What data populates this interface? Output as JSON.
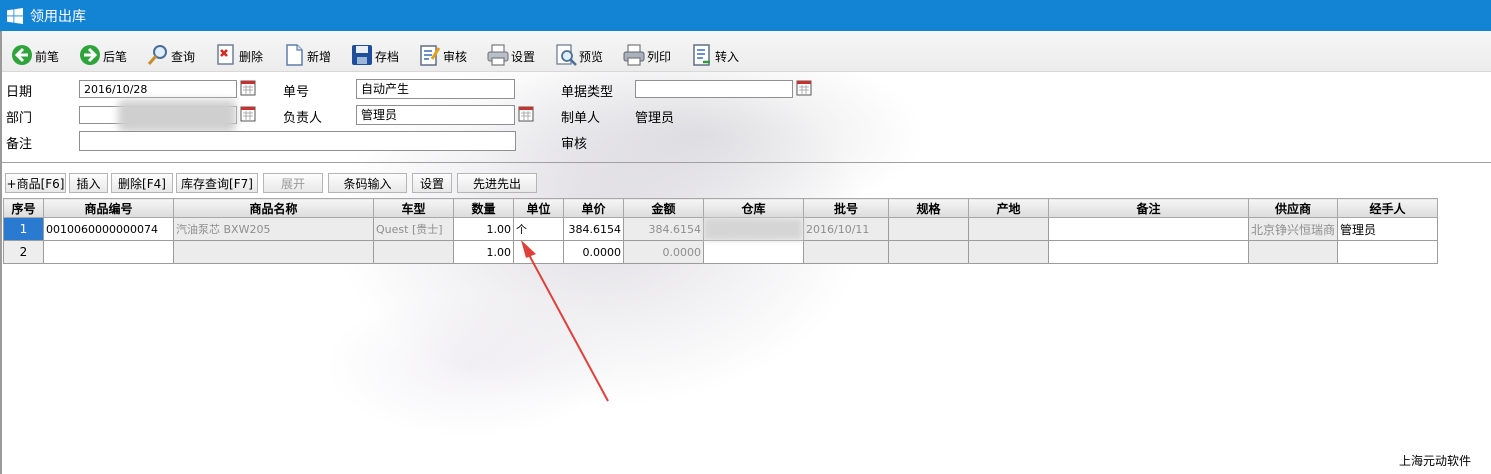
{
  "window": {
    "title": "领用出库"
  },
  "toolbar": [
    {
      "label": "前笔",
      "icon": "back-arrow-icon"
    },
    {
      "label": "后笔",
      "icon": "forward-arrow-icon"
    },
    {
      "label": "查询",
      "icon": "magnifier-icon"
    },
    {
      "label": "删除",
      "icon": "delete-doc-icon"
    },
    {
      "label": "新增",
      "icon": "new-doc-icon"
    },
    {
      "label": "存档",
      "icon": "save-disk-icon"
    },
    {
      "label": "审核",
      "icon": "audit-doc-icon"
    },
    {
      "label": "设置",
      "icon": "printer-setup-icon"
    },
    {
      "label": "预览",
      "icon": "preview-icon"
    },
    {
      "label": "列印",
      "icon": "printer-icon"
    },
    {
      "label": "转入",
      "icon": "import-doc-icon"
    }
  ],
  "form": {
    "date_label": "日期",
    "date_value": "2016/10/28",
    "order_no_label": "单号",
    "order_no_value": "自动产生",
    "doc_type_label": "单据类型",
    "doc_type_value": "",
    "dept_label": "部门",
    "owner_label": "负责人",
    "owner_value": "管理员",
    "maker_label": "制单人",
    "maker_value": "管理员",
    "remark_label": "备注",
    "remark_value": "",
    "audit_label": "审核"
  },
  "grid_toolbar": [
    {
      "label": "+商品[F6]",
      "enabled": true
    },
    {
      "label": "插入",
      "enabled": true
    },
    {
      "label": "删除[F4]",
      "enabled": true
    },
    {
      "label": "库存查询[F7]",
      "enabled": true
    },
    {
      "label": "展开",
      "enabled": false
    },
    {
      "label": "条码输入",
      "enabled": true
    },
    {
      "label": "设置",
      "enabled": true
    },
    {
      "label": "先进先出",
      "enabled": true
    }
  ],
  "grid": {
    "columns": [
      "序号",
      "商品编号",
      "商品名称",
      "车型",
      "数量",
      "单位",
      "单价",
      "金额",
      "仓库",
      "批号",
      "规格",
      "产地",
      "备注",
      "供应商",
      "经手人"
    ],
    "rows": [
      {
        "idx": "1",
        "code": "0010060000000074",
        "name": "汽油泵芯 BXW205",
        "model": "Quest [贵士]",
        "qty": "1.00",
        "unit": "个",
        "price": "384.6154",
        "amount": "384.6154",
        "batch": "2016/10/11",
        "spec": "",
        "origin": "",
        "remark": "",
        "supplier": "北京铮兴恒瑞商",
        "handler": "管理员"
      },
      {
        "idx": "2",
        "code": "",
        "name": "",
        "model": "",
        "qty": "1.00",
        "unit": "",
        "price": "0.0000",
        "amount": "0.0000",
        "batch": "",
        "spec": "",
        "origin": "",
        "remark": "",
        "supplier": "",
        "handler": ""
      }
    ]
  },
  "footer": {
    "brand": "上海元动软件"
  },
  "colors": {
    "titlebar": "#1383d4",
    "selected_row_index": "#2a7ad1",
    "annotation_arrow": "#e0403a"
  }
}
